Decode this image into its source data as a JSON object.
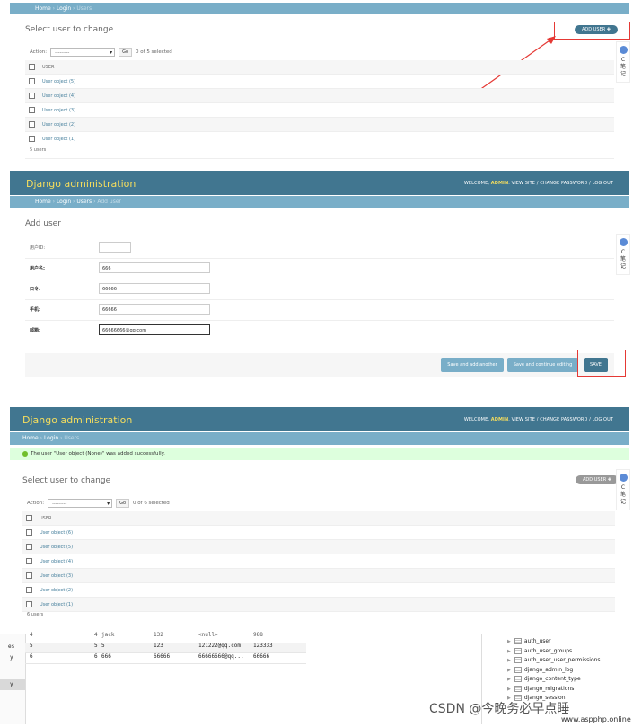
{
  "breadcrumb_list": {
    "home": "Home",
    "login": "Login",
    "current": "Users"
  },
  "breadcrumb_add": {
    "home": "Home",
    "login": "Login",
    "users": "Users",
    "current": "Add user"
  },
  "list1": {
    "title": "Select user to change",
    "action_label": "Action:",
    "action_value": "---------",
    "go": "Go",
    "selected": "0 of 5 selected",
    "add_user": "ADD USER",
    "column": "USER",
    "rows": [
      "User object (5)",
      "User object (4)",
      "User object (3)",
      "User object (2)",
      "User object (1)"
    ],
    "count": "5 users"
  },
  "side_widget": {
    "label": "C",
    "line2": "笔",
    "line3": "记"
  },
  "header": {
    "brand": "Django administration",
    "welcome": "WELCOME,",
    "user": "ADMIN",
    "view_site": "VIEW SITE",
    "change_password": "CHANGE PASSWORD",
    "logout": "LOG OUT",
    "sep": "/"
  },
  "add_form": {
    "title": "Add user",
    "fields": [
      {
        "label": "用户ID:",
        "value": ""
      },
      {
        "label": "用户名:",
        "value": "666"
      },
      {
        "label": "口令:",
        "value": "66666"
      },
      {
        "label": "手机:",
        "value": "66666"
      },
      {
        "label": "邮箱:",
        "value": "66666666@qq.com"
      }
    ],
    "save_add_another": "Save and add another",
    "save_continue": "Save and continue editing",
    "save": "SAVE"
  },
  "list2": {
    "message": "The user \"User object (None)\" was added successfully.",
    "title": "Select user to change",
    "action_label": "Action:",
    "action_value": "---------",
    "go": "Go",
    "selected": "0 of 6 selected",
    "add_user": "ADD USER",
    "column": "USER",
    "rows": [
      "User object (6)",
      "User object (5)",
      "User object (4)",
      "User object (3)",
      "User object (2)",
      "User object (1)"
    ],
    "count": "6 users"
  },
  "db_rows": [
    {
      "idx": "4",
      "id": "4",
      "name": "jack",
      "pwd": "132",
      "email": "<null>",
      "phone": "988"
    },
    {
      "idx": "5",
      "id": "5",
      "name": "5",
      "pwd": "123",
      "email": "121222@qq.com",
      "phone": "123333"
    },
    {
      "idx": "6",
      "id": "6",
      "name": "666",
      "pwd": "66666",
      "email": "66666666@qq...",
      "phone": "66666"
    }
  ],
  "db_left_fragments": [
    "es",
    "y",
    "y"
  ],
  "db_tables": [
    "auth_user",
    "auth_user_groups",
    "auth_user_user_permissions",
    "django_admin_log",
    "django_content_type",
    "django_migrations",
    "django_session"
  ],
  "watermark": {
    "csdn": "CSDN @今晚务必早点睡",
    "site": "www.aspphp.online"
  }
}
